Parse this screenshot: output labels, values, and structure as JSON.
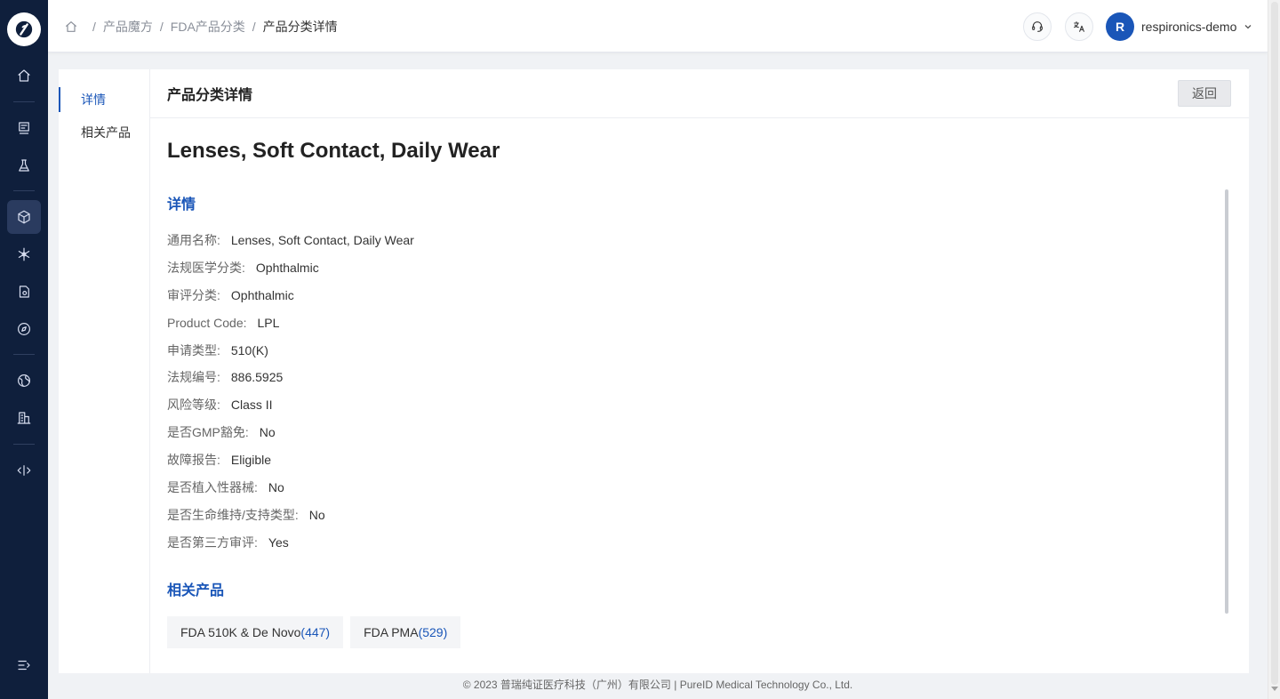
{
  "breadcrumb": {
    "items": [
      "产品魔方",
      "FDA产品分类"
    ],
    "separator": "/",
    "current": "产品分类详情"
  },
  "header": {
    "support_icon": "headset-icon",
    "translate_icon": "translate-icon",
    "user": {
      "avatar_letter": "R",
      "name": "respironics-demo"
    }
  },
  "rail": {
    "icons": [
      "home-icon",
      "report-icon",
      "flask-icon",
      "cube-icon",
      "snowflake-icon",
      "document-icon",
      "compass-icon",
      "globe-icon",
      "building-icon",
      "code-icon",
      "collapse-icon"
    ],
    "active": "cube-icon"
  },
  "subnav": {
    "items": [
      "详情",
      "相关产品"
    ],
    "active_index": 0
  },
  "page": {
    "title": "产品分类详情",
    "back_label": "返回",
    "heading": "Lenses, Soft Contact, Daily Wear",
    "details_title": "详情",
    "properties": [
      {
        "label": "通用名称:",
        "value": "Lenses, Soft Contact, Daily Wear"
      },
      {
        "label": "法规医学分类:",
        "value": "Ophthalmic"
      },
      {
        "label": "审评分类:",
        "value": "Ophthalmic"
      },
      {
        "label": "Product Code:",
        "value": "LPL"
      },
      {
        "label": "申请类型:",
        "value": "510(K)"
      },
      {
        "label": "法规编号:",
        "value": "886.5925"
      },
      {
        "label": "风险等级:",
        "value": "Class II"
      },
      {
        "label": "是否GMP豁免:",
        "value": "No"
      },
      {
        "label": "故障报告:",
        "value": "Eligible"
      },
      {
        "label": "是否植入性器械:",
        "value": "No"
      },
      {
        "label": "是否生命维持/支持类型:",
        "value": "No"
      },
      {
        "label": "是否第三方审评:",
        "value": "Yes"
      }
    ],
    "related_title": "相关产品",
    "related": [
      {
        "label": "FDA 510K & De Novo",
        "count": "(447)"
      },
      {
        "label": "FDA PMA",
        "count": "(529)"
      }
    ]
  },
  "footer": {
    "text": "© 2023 普瑞纯证医疗科技（广州）有限公司 | PureID Medical Technology Co., Ltd."
  },
  "colors": {
    "accent": "#1a56b8",
    "rail_bg": "#0f1f3c"
  }
}
